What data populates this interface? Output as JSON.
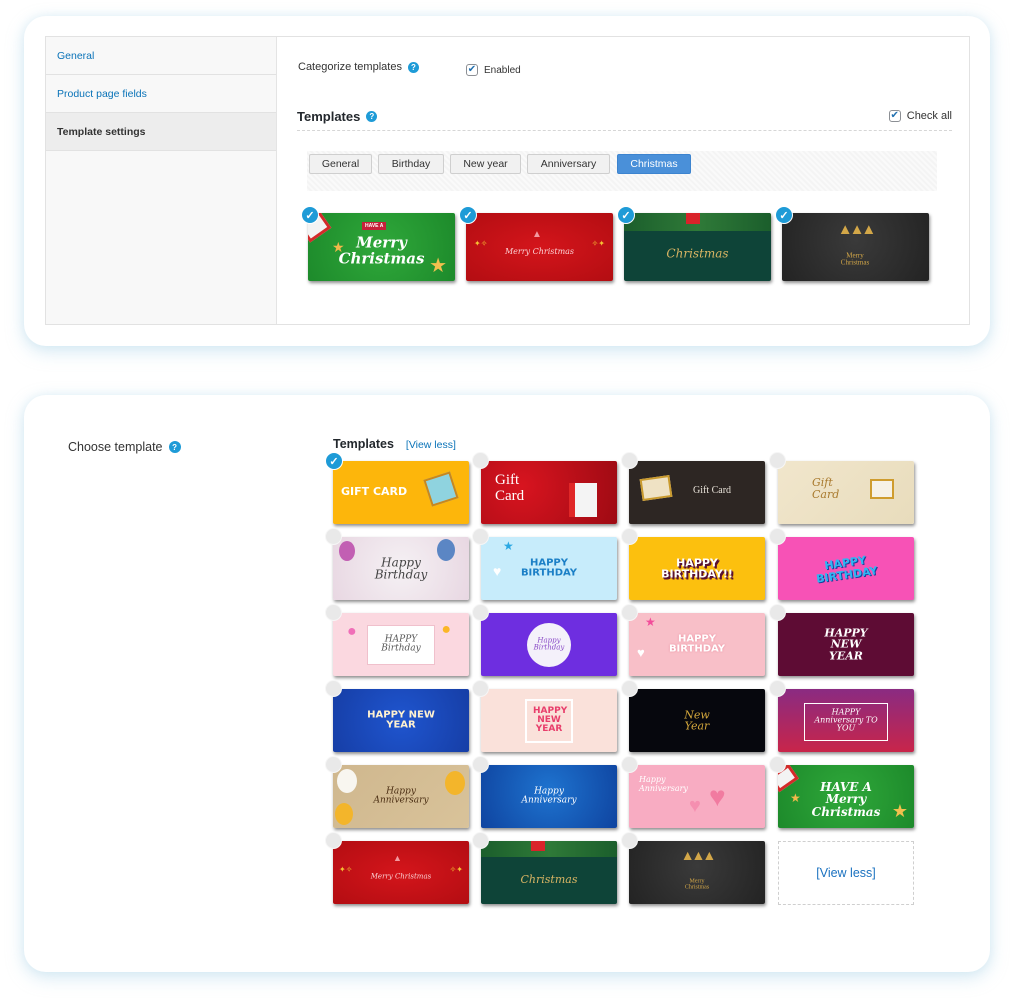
{
  "settings": {
    "sidebar": {
      "items": [
        {
          "label": "General",
          "active": false
        },
        {
          "label": "Product page fields",
          "active": false
        },
        {
          "label": "Template settings",
          "active": true
        }
      ]
    },
    "categorize": {
      "label": "Categorize templates",
      "help_icon": "question-circle-icon",
      "checkbox_label": "Enabled",
      "checked": true
    },
    "templates_section": {
      "title": "Templates",
      "help_icon": "question-circle-icon",
      "check_all_label": "Check all",
      "check_all_checked": true
    },
    "category_tabs": [
      {
        "label": "General",
        "active": false
      },
      {
        "label": "Birthday",
        "active": false
      },
      {
        "label": "New year",
        "active": false
      },
      {
        "label": "Anniversary",
        "active": false
      },
      {
        "label": "Christmas",
        "active": true
      }
    ],
    "christmas_templates": [
      {
        "name": "Have a Merry Christmas (green)",
        "badge": "HAVE A",
        "text": "Merry Christmas",
        "selected": true
      },
      {
        "name": "Merry Christmas (red)",
        "text": "Merry Christmas",
        "selected": true
      },
      {
        "name": "Christmas (dark green)",
        "text": "Christmas",
        "selected": true
      },
      {
        "name": "Merry Christmas (dark gold trees)",
        "text": "Merry Christmas",
        "selected": true
      }
    ]
  },
  "chooser": {
    "label": "Choose template",
    "help_icon": "question-circle-icon",
    "templates_title": "Templates",
    "view_less_link": "[View less]",
    "view_less_cell": "[View less]",
    "templates": [
      {
        "text": "GIFT CARD",
        "selected": true
      },
      {
        "text": "Gift Card",
        "selected": false
      },
      {
        "text": "Gift Card",
        "selected": false
      },
      {
        "text": "Gift Card",
        "selected": false
      },
      {
        "text": "Happy Birthday",
        "selected": false
      },
      {
        "text": "HAPPY BIRTHDAY",
        "selected": false
      },
      {
        "text": "HAPPY BIRTHDAY!!",
        "selected": false
      },
      {
        "text": "HAPPY BIRTHDAY",
        "selected": false
      },
      {
        "text": "HAPPY Birthday",
        "selected": false
      },
      {
        "text": "Happy Birthday",
        "selected": false
      },
      {
        "text": "HAPPY BIRTHDAY",
        "selected": false
      },
      {
        "text": "HAPPY NEW YEAR",
        "selected": false
      },
      {
        "text": "HAPPY NEW YEAR",
        "selected": false
      },
      {
        "text": "HAPPY NEW YEAR",
        "selected": false
      },
      {
        "text": "New Year",
        "selected": false
      },
      {
        "text": "HAPPY Anniversary TO YOU",
        "selected": false
      },
      {
        "text": "Happy Anniversary",
        "selected": false
      },
      {
        "text": "Happy Anniversary",
        "selected": false
      },
      {
        "text": "Happy Anniversary",
        "selected": false
      },
      {
        "text": "HAVE A Merry Christmas",
        "selected": false
      },
      {
        "text": "Merry Christmas",
        "selected": false
      },
      {
        "text": "Christmas",
        "selected": false
      },
      {
        "text": "Merry Christmas",
        "selected": false
      }
    ]
  }
}
